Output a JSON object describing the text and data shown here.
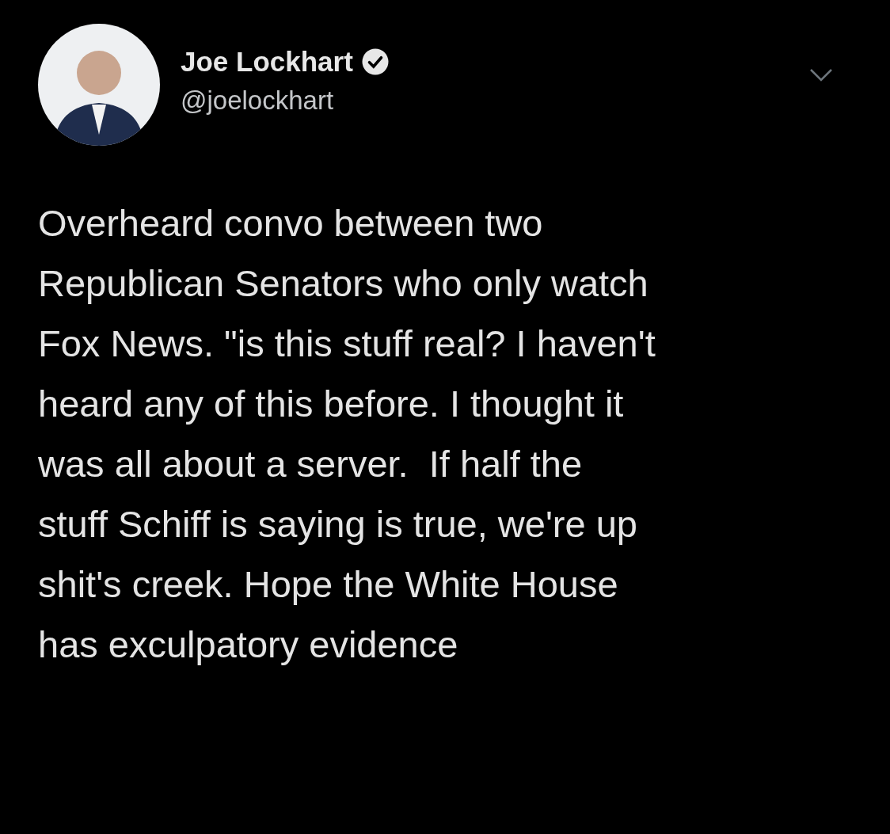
{
  "author": {
    "name": "Joe Lockhart",
    "verified": true,
    "handle": "@joelockhart"
  },
  "tweet": {
    "text": "Overheard convo between two\nRepublican Senators who only watch\nFox News. \"is this stuff real? I haven't\nheard any of this before. I thought it\nwas all about a server.  If half the\nstuff Schiff is saying is true, we're up\nshit's creek. Hope the White House\nhas exculpatory evidence"
  }
}
